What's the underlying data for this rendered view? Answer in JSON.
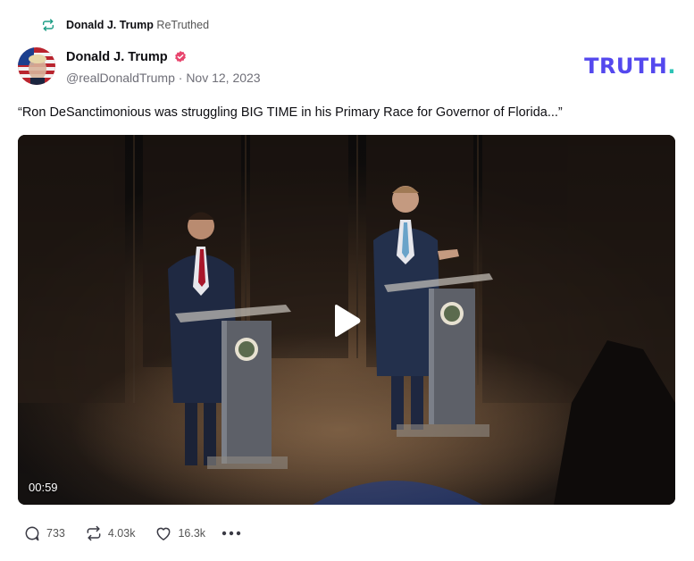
{
  "retruth": {
    "user": "Donald J. Trump",
    "label": "ReTruthed",
    "icon": "retruth-icon"
  },
  "author": {
    "display_name": "Donald J. Trump",
    "handle": "@realDonaldTrump",
    "separator": "·",
    "date": "Nov 12, 2023",
    "verified_icon": "verified-badge-icon",
    "verified_color": "#e8456d"
  },
  "brand": {
    "logo_main": "TRUTH",
    "logo_dot": ".",
    "primary_color": "#5448ee",
    "dot_color": "#2ec4b6"
  },
  "post": {
    "text": "“Ron DeSanctimonious was struggling BIG TIME in his Primary Race for Governor of Florida...”"
  },
  "video": {
    "duration": "00:59",
    "play_icon": "play-icon"
  },
  "actions": {
    "replies": {
      "icon": "reply-icon",
      "count": "733"
    },
    "retruths": {
      "icon": "retruth-icon",
      "count": "4.03k"
    },
    "likes": {
      "icon": "heart-icon",
      "count": "16.3k"
    },
    "more_icon": "more-dots-icon"
  }
}
